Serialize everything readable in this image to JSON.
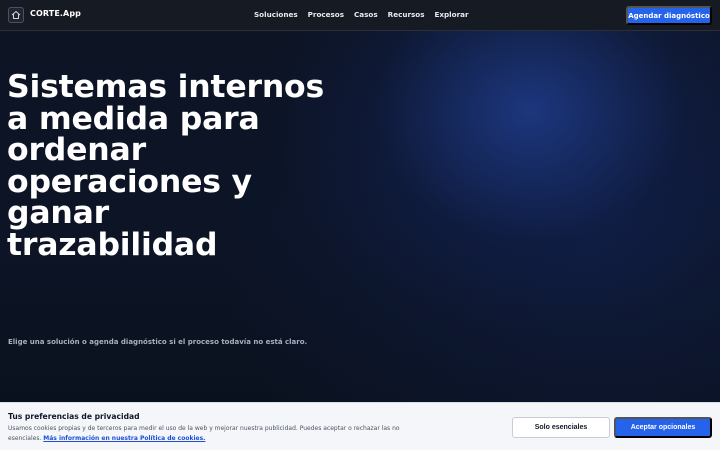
{
  "nav": {
    "brand": "CORTE.App",
    "logo_icon": "home-icon",
    "links": [
      "Soluciones",
      "Procesos",
      "Casos",
      "Recursos",
      "Explorar"
    ],
    "cta_label": "Agendar diagnóstico"
  },
  "hero": {
    "headline_lines": [
      "Sistemas internos",
      "a medida para",
      "ordenar",
      "operaciones y",
      "ganar trazabilidad"
    ],
    "subtitle": "Elige una solución o agenda diagnóstico si el proceso todavía no está claro."
  },
  "cookie": {
    "title": "Tus preferencias de privacidad",
    "text": "Usamos cookies propias y de terceros para medir el uso de la web y mejorar nuestra publicidad. Puedes aceptar o rechazar las no esenciales.",
    "link_text": "Más información en nuestra Política de cookies.",
    "essential_label": "Solo esenciales",
    "accept_label": "Aceptar opcionales"
  },
  "colors": {
    "accent": "#2563eb",
    "background": "#0b1220",
    "nav_background": "#161a22",
    "banner_background": "#f4f6f9"
  }
}
